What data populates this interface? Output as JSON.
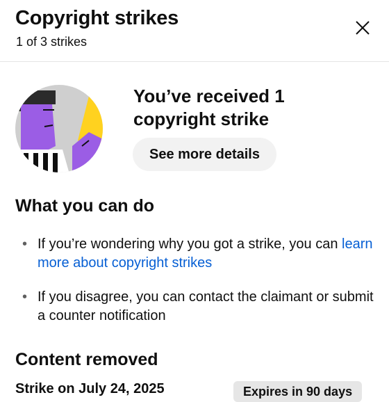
{
  "header": {
    "title": "Copyright strikes",
    "subtitle": "1 of 3 strikes",
    "close_icon": "close-icon"
  },
  "hero": {
    "illustration_icon": "person-holding-card-illustration",
    "title": "You’ve received 1 copyright strike",
    "button_label": "See more details"
  },
  "what_you_can_do": {
    "heading": "What you can do",
    "bullets": [
      {
        "text_before_link": "If you’re wondering why you got a strike, you can ",
        "link_text": "learn more about copyright strikes"
      },
      {
        "text": "If you disagree, you can contact the claimant or submit a counter notification"
      }
    ]
  },
  "content_removed": {
    "heading": "Content removed",
    "strike_date": "Strike on July 24, 2025",
    "expires_badge": "Expires in 90 days"
  },
  "colors": {
    "link": "#065fd4",
    "button_bg": "#f2f2f2",
    "illustration_purple": "#9b5de5",
    "illustration_yellow": "#ffd21f",
    "illustration_gray": "#cfcfcf"
  }
}
